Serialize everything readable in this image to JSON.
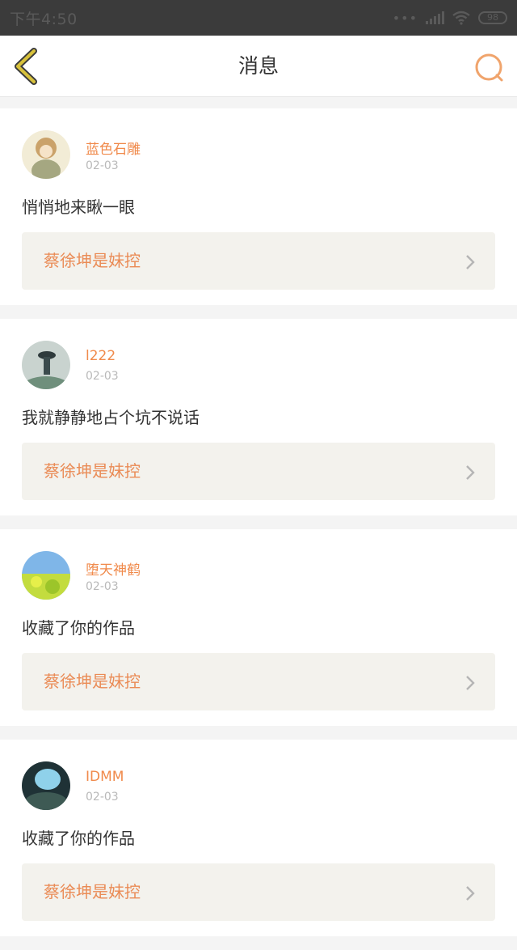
{
  "status_bar": {
    "time": "下午4:50",
    "battery": "98",
    "icons": [
      "more-dots-icon",
      "signal-icon",
      "wifi-icon",
      "battery-icon"
    ]
  },
  "nav": {
    "title": "消息",
    "back_icon": "chevron-left-icon",
    "search_icon": "search-icon"
  },
  "colors": {
    "accent": "#f08a4b",
    "back_icon": "#d7c13b",
    "link_bg": "#f3f2ed"
  },
  "messages": [
    {
      "user": "蓝色石雕",
      "date": "02-03",
      "text": "悄悄地来瞅一眼",
      "link": "蔡徐坤是妹控"
    },
    {
      "user": "l222",
      "date": "02-03",
      "text": "我就静静地占个坑不说话",
      "link": "蔡徐坤是妹控"
    },
    {
      "user": "堕天神鹤",
      "date": "02-03",
      "text": "收藏了你的作品",
      "link": "蔡徐坤是妹控"
    },
    {
      "user": "IDMM",
      "date": "02-03",
      "text": "收藏了你的作品",
      "link": "蔡徐坤是妹控"
    }
  ]
}
